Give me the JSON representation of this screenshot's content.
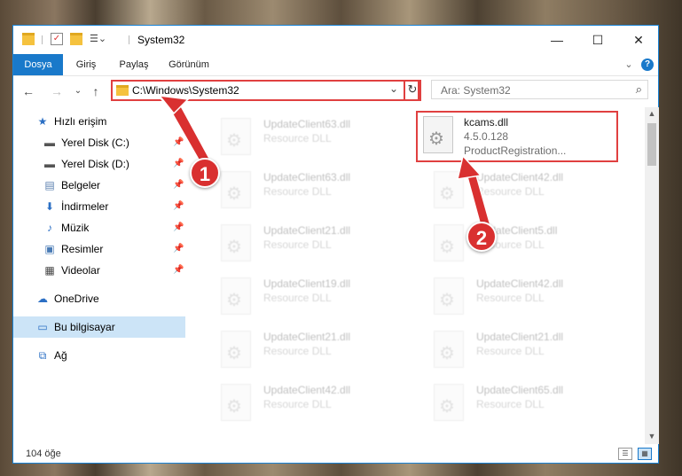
{
  "window": {
    "title": "System32",
    "controls": {
      "minimize": "—",
      "maximize": "☐",
      "close": "✕"
    }
  },
  "ribbon": {
    "tabs": [
      {
        "label": "Dosya",
        "active": true
      },
      {
        "label": "Giriş"
      },
      {
        "label": "Paylaş"
      },
      {
        "label": "Görünüm"
      }
    ],
    "collapse": "⌄",
    "help": "?"
  },
  "navigation": {
    "back": "←",
    "forward": "→",
    "recent": "⌄",
    "up": "↑",
    "address": "C:\\Windows\\System32",
    "address_drop": "⌄",
    "refresh": "↻",
    "search_placeholder": "Ara: System32",
    "search_icon": "⌕"
  },
  "navpane": {
    "items": [
      {
        "label": "Hızlı erişim",
        "icon": "star-icon",
        "glyph": "★",
        "color": "#2b6fc4"
      },
      {
        "label": "Yerel Disk (C:)",
        "icon": "drive-icon",
        "glyph": "▬",
        "color": "#555555",
        "pinned": true
      },
      {
        "label": "Yerel Disk (D:)",
        "icon": "drive-icon",
        "glyph": "▬",
        "color": "#555555",
        "pinned": true
      },
      {
        "label": "Belgeler",
        "icon": "documents-icon",
        "glyph": "▤",
        "color": "#5a7fae",
        "pinned": true
      },
      {
        "label": "İndirmeler",
        "icon": "download-icon",
        "glyph": "⬇",
        "color": "#2b6fc4",
        "pinned": true
      },
      {
        "label": "Müzik",
        "icon": "music-icon",
        "glyph": "♪",
        "color": "#2b6fc4",
        "pinned": true
      },
      {
        "label": "Resimler",
        "icon": "pictures-icon",
        "glyph": "▣",
        "color": "#4a7bb5",
        "pinned": true
      },
      {
        "label": "Videolar",
        "icon": "videos-icon",
        "glyph": "▦",
        "color": "#444444",
        "pinned": true
      },
      {
        "label": "OneDrive",
        "icon": "cloud-icon",
        "glyph": "☁",
        "color": "#2b6fc4"
      },
      {
        "label": "Bu bilgisayar",
        "icon": "computer-icon",
        "glyph": "▭",
        "color": "#2b6fc4",
        "selected": true
      },
      {
        "label": "Ağ",
        "icon": "network-icon",
        "glyph": "⧉",
        "color": "#2b6fc4"
      }
    ],
    "pin_glyph": "📌"
  },
  "files": {
    "left": [
      {
        "name": "UpdateClient63.dll",
        "desc": "Resource DLL"
      },
      {
        "name": "UpdateClient63.dll",
        "desc": "Resource DLL"
      },
      {
        "name": "UpdateClient21.dll",
        "desc": "Resource DLL"
      },
      {
        "name": "UpdateClient19.dll",
        "desc": "Resource DLL"
      },
      {
        "name": "UpdateClient21.dll",
        "desc": "Resource DLL"
      },
      {
        "name": "UpdateClient42.dll",
        "desc": "Resource DLL"
      }
    ],
    "right": [
      {
        "name": "kcams.dll",
        "desc": "4.5.0.128",
        "desc2": "ProductRegistration...",
        "highlight": true
      },
      {
        "name": "UpdateClient42.dll",
        "desc": "Resource DLL"
      },
      {
        "name": "UpdateClient5.dll",
        "desc": "Resource DLL"
      },
      {
        "name": "UpdateClient42.dll",
        "desc": "Resource DLL"
      },
      {
        "name": "UpdateClient21.dll",
        "desc": "Resource DLL"
      },
      {
        "name": "UpdateClient65.dll",
        "desc": "Resource DLL"
      }
    ]
  },
  "status": {
    "count": "104 öğe"
  },
  "callouts": [
    {
      "label": "1"
    },
    {
      "label": "2"
    }
  ],
  "colors": {
    "accent": "#1979ca",
    "highlight": "#e04040",
    "selected": "#cce4f7"
  }
}
